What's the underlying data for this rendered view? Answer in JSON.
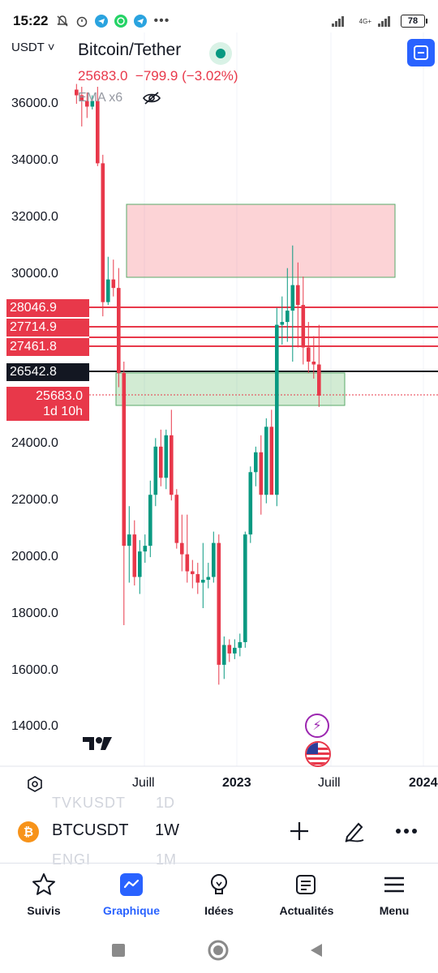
{
  "status_bar": {
    "time": "15:22",
    "network": "4G+",
    "battery": "78"
  },
  "chart": {
    "currency": "USDT",
    "symbol_name": "Bitcoin/Tether",
    "last_price": "25683.0",
    "change": "−799.9 (−3.02%)",
    "indicator": "EMA x6",
    "y_ticks": [
      "36000.0",
      "34000.0",
      "32000.0",
      "30000.0",
      "24000.0",
      "22000.0",
      "20000.0",
      "18000.0",
      "16000.0",
      "14000.0"
    ],
    "price_labels": {
      "l1": "28046.9",
      "l2": "27714.9",
      "l3": "27461.8",
      "crosshair": "26542.8",
      "current": "25683.0",
      "countdown": "1d 10h"
    },
    "x_ticks": {
      "t1": "Juill",
      "t2": "2023",
      "t3": "Juill",
      "t4": "2024"
    },
    "colors": {
      "up": "#089981",
      "down": "#e8384a",
      "accent": "#2962ff"
    }
  },
  "symbol_bar": {
    "ghost_top": "TVKUSDT",
    "ghost_top_tf": "1D",
    "ticker": "BTCUSDT",
    "timeframe": "1W",
    "ghost_bottom": "ENGI",
    "ghost_bottom_tf": "1M"
  },
  "bottom_nav": {
    "items": [
      {
        "label": "Suivis",
        "icon": "star-icon"
      },
      {
        "label": "Graphique",
        "icon": "chart-icon"
      },
      {
        "label": "Idées",
        "icon": "lightbulb-icon"
      },
      {
        "label": "Actualités",
        "icon": "news-icon"
      },
      {
        "label": "Menu",
        "icon": "menu-icon"
      }
    ]
  }
}
